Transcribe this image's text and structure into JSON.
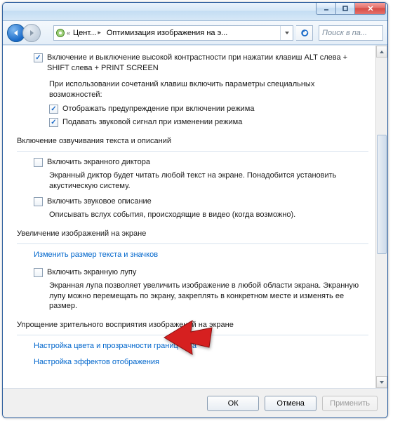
{
  "window": {
    "minimize": "–",
    "maximize": "□"
  },
  "nav": {
    "crumb1": "Цент...",
    "crumb2": "Оптимизация изображения на э...",
    "search_placeholder": "Поиск в па..."
  },
  "top_section": {
    "high_contrast_label": "Включение и выключение высокой контрастности при нажатии клавиш ALT слева + SHIFT слева + PRINT SCREEN",
    "combo_intro": "При использовании сочетаний клавиш включить параметры специальных возможностей:",
    "warn_label": "Отображать предупреждение при включении режима",
    "sound_label": "Подавать звуковой сигнал при изменении режима"
  },
  "narration": {
    "group_title": "Включение озвучивания текста и описаний",
    "narrator_label": "Включить экранного диктора",
    "narrator_desc": "Экранный диктор будет читать любой текст на экране. Понадобится установить акустическую систему.",
    "audio_desc_label": "Включить звуковое описание",
    "audio_desc_desc": "Описывать вслух события, происходящие в видео (когда возможно)."
  },
  "magnify": {
    "group_title": "Увеличение изображений на экране",
    "resize_link": "Изменить размер текста и значков",
    "magnifier_label": "Включить экранную лупу",
    "magnifier_desc": "Экранная лупа позволяет увеличить изображение в любой области экрана. Экранную лупу можно перемещать по экрану, закреплять в конкретном месте и изменять ее размер."
  },
  "simplify": {
    "group_title": "Упрощение зрительного восприятия изображений на экране",
    "color_link": "Настройка цвета и прозрачности границ окна",
    "effects_link": "Настройка эффектов отображения"
  },
  "buttons": {
    "ok": "ОК",
    "cancel": "Отмена",
    "apply": "Применить"
  }
}
